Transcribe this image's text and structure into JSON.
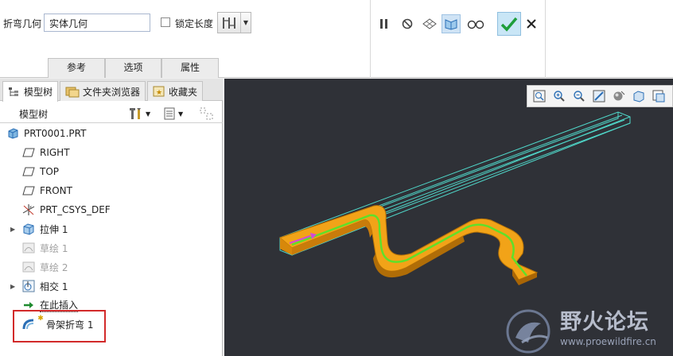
{
  "ribbon": {
    "bend_geometry_label": "折弯几何",
    "bend_geometry_value": "实体几何",
    "lock_length_label": "锁定长度",
    "tabs": [
      {
        "label": "参考"
      },
      {
        "label": "选项"
      },
      {
        "label": "属性"
      }
    ]
  },
  "panel": {
    "tabs": [
      {
        "label": "模型树"
      },
      {
        "label": "文件夹浏览器"
      },
      {
        "label": "收藏夹"
      }
    ],
    "tree_title": "模型树"
  },
  "tree": {
    "items": [
      {
        "label": "PRT0001.PRT"
      },
      {
        "label": "RIGHT"
      },
      {
        "label": "TOP"
      },
      {
        "label": "FRONT"
      },
      {
        "label": "PRT_CSYS_DEF"
      },
      {
        "label": "拉伸 1"
      },
      {
        "label": "草绘 1"
      },
      {
        "label": "草绘 2"
      },
      {
        "label": "相交 1"
      },
      {
        "label": "在此插入"
      },
      {
        "label": "骨架折弯 1"
      }
    ]
  },
  "watermark": {
    "title": "野火论坛",
    "url": "www.proewildfire.cn"
  },
  "colors": {
    "accent": "#2b6fb6",
    "confirm": "#1e9e3a",
    "highlight": "#d22a2a",
    "viewport_bg": "#2f3137",
    "part_orange": "#f2a318",
    "trajectory_green": "#5fe02a"
  },
  "icons": {
    "pause": "pause-icon",
    "stop": "stop-icon",
    "preview": "preview-icon",
    "verify": "verify-icon",
    "glasses": "glasses-icon",
    "check": "check-icon",
    "close": "close-icon"
  }
}
